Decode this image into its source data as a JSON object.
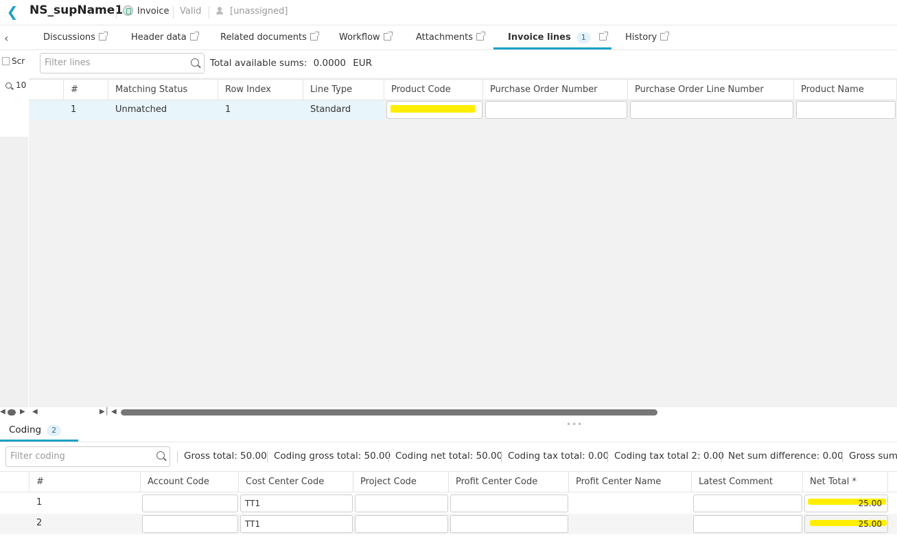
{
  "header": {
    "title": "NS_supName1",
    "doc_type": "Invoice",
    "status": "Valid",
    "assignee": "[unassigned]"
  },
  "tabs": [
    {
      "label": "Discussions"
    },
    {
      "label": "Header data"
    },
    {
      "label": "Related documents"
    },
    {
      "label": "Workflow"
    },
    {
      "label": "Attachments"
    },
    {
      "label": "Invoice lines",
      "badge": "1",
      "active": true
    },
    {
      "label": "History"
    }
  ],
  "left_panel": {
    "item1": "Scr",
    "item2": "10"
  },
  "lines": {
    "filter_placeholder": "Filter lines",
    "sums_label": "Total available sums:",
    "sums_value": "0.0000",
    "sums_currency": "EUR",
    "columns": [
      "#",
      "Matching Status",
      "Row Index",
      "Line Type",
      "Product Code",
      "Purchase Order Number",
      "Purchase Order Line Number",
      "Product Name"
    ],
    "rows": [
      {
        "num": "1",
        "matching_status": "Unmatched",
        "row_index": "1",
        "line_type": "Standard",
        "product_code": "",
        "po_number": "",
        "po_line_number": "",
        "product_name": ""
      }
    ]
  },
  "coding": {
    "tab_label": "Coding",
    "tab_badge": "2",
    "filter_placeholder": "Filter coding",
    "totals": [
      "Gross total: 50.00",
      "Coding gross total: 50.00",
      "Coding net total: 50.00",
      "Coding tax total: 0.00",
      "Coding tax total 2: 0.00",
      "Net sum difference: 0.00",
      "Gross sum"
    ],
    "columns": [
      "#",
      "Account Code",
      "Cost Center Code",
      "Project Code",
      "Profit Center Code",
      "Profit Center Name",
      "Latest Comment",
      "Net Total *"
    ],
    "rows": [
      {
        "num": "1",
        "account_code": "",
        "cost_center": "TT1",
        "project_code": "",
        "profit_center_code": "",
        "profit_center_name": "",
        "latest_comment": "",
        "net_total": "25.00"
      },
      {
        "num": "2",
        "account_code": "",
        "cost_center": "TT1",
        "project_code": "",
        "profit_center_code": "",
        "profit_center_name": "",
        "latest_comment": "",
        "net_total": "25.00"
      }
    ]
  },
  "colors": {
    "accent": "#1aa0c8",
    "highlight": "#ffee00",
    "selected_row": "#e8f5fb"
  }
}
